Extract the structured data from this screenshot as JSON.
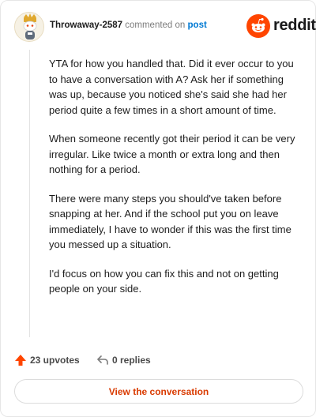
{
  "header": {
    "username": "Throwaway-2587",
    "action_text": "commented on",
    "post_link": "post",
    "brand_name": "reddit"
  },
  "comment": {
    "paragraphs": [
      "YTA for how you handled that. Did it ever occur to you to have a conversation with A? Ask her if something was up, because you noticed she's said she had her period quite a few times in a short amount of time.",
      "When someone recently got their period it can be very irregular. Like twice a month or extra long and then nothing for a period.",
      "There were many steps you should've taken before snapping at her. And if the school put you on leave immediately, I have to wonder if this was the first time you messed up a situation.",
      "I'd focus on how you can fix this and not on getting people on your side."
    ]
  },
  "actions": {
    "upvotes_label": "23 upvotes",
    "replies_label": "0 replies"
  },
  "footer": {
    "view_button_label": "View the conversation"
  },
  "colors": {
    "brand_orange": "#ff4500",
    "link_blue": "#0079d3",
    "button_text": "#d93a00"
  },
  "icons": {
    "avatar": "snoo-avatar",
    "brand": "reddit-logo-icon",
    "upvote": "upvote-arrow-icon",
    "reply": "reply-arrow-icon"
  }
}
